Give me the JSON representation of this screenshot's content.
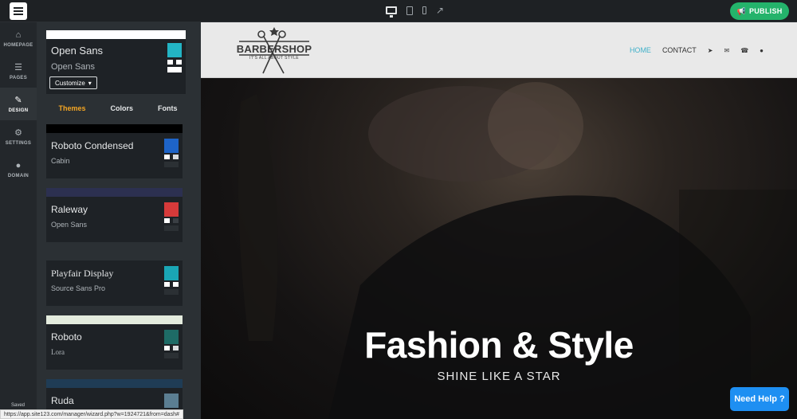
{
  "topbar": {
    "devices": [
      "desktop-icon",
      "tablet-icon",
      "phone-icon",
      "external-link-icon"
    ],
    "publish_label": "PUBLISH"
  },
  "leftnav": {
    "items": [
      {
        "label": "HOMEPAGE",
        "icon": "home-icon"
      },
      {
        "label": "PAGES",
        "icon": "pages-icon"
      },
      {
        "label": "DESIGN",
        "icon": "brush-icon",
        "active": true
      },
      {
        "label": "SETTINGS",
        "icon": "gear-icon"
      },
      {
        "label": "DOMAIN",
        "icon": "globe-icon"
      }
    ],
    "saved": "Saved"
  },
  "panel": {
    "current": {
      "heading_font": "Open Sans",
      "body_font": "Open Sans",
      "customize_label": "Customize",
      "colors": {
        "main": "#23b4c4",
        "accent": "#ffffff"
      }
    },
    "tabs": [
      {
        "label": "Themes",
        "active": true
      },
      {
        "label": "Colors"
      },
      {
        "label": "Fonts"
      }
    ],
    "themes": [
      {
        "heading": "Roboto Condensed",
        "body": "Cabin",
        "strip": "#000000",
        "main": "#1e64c8"
      },
      {
        "heading": "Raleway",
        "body": "Open Sans",
        "strip": "#2c3050",
        "main": "#d63a3a"
      },
      {
        "heading": "Playfair Display",
        "body": "Source Sans Pro",
        "strip": "#2b3034",
        "main": "#1aa6b5"
      },
      {
        "heading": "Roboto",
        "body": "Lora",
        "strip": "#e4ecde",
        "main": "#1e6b66"
      },
      {
        "heading": "Ruda",
        "body": "",
        "strip": "#1f3c55",
        "main": "#5b7e92"
      }
    ]
  },
  "site": {
    "brand": "BARBERSHOP",
    "tagline": "IT'S ALL ABOUT STYLE",
    "menu": [
      {
        "label": "HOME",
        "active": true
      },
      {
        "label": "CONTACT"
      }
    ],
    "menu_icons": [
      "location-arrow-icon",
      "envelope-icon",
      "phone-icon",
      "user-icon"
    ],
    "hero_title": "Fashion & Style",
    "hero_subtitle": "SHINE LIKE A STAR"
  },
  "help_label": "Need Help ?",
  "status_url": "https://app.site123.com/manager/wizard.php?w=1924721&from=dash#"
}
